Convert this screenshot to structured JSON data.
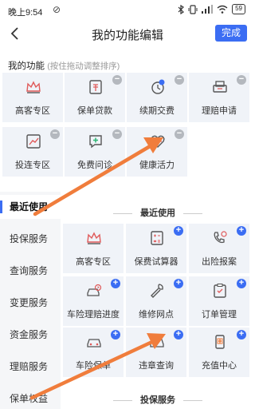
{
  "status_bar": {
    "time": "晚上9:54",
    "mute_glyph": "⊘",
    "battery": "59"
  },
  "nav": {
    "title": "我的功能编辑",
    "done": "完成"
  },
  "my_functions": {
    "title": "我的功能",
    "hint": "(按住拖动调整排序)",
    "items": [
      {
        "label": "高客专区",
        "icon": "crown-icon"
      },
      {
        "label": "保单贷款",
        "icon": "loan-doc-icon"
      },
      {
        "label": "续期交费",
        "icon": "renewal-payment-icon"
      },
      {
        "label": "理赔申请",
        "icon": "claim-print-icon"
      },
      {
        "label": "投连专区",
        "icon": "chart-trend-icon"
      },
      {
        "label": "免费问诊",
        "icon": "medical-chat-icon"
      },
      {
        "label": "健康活力",
        "icon": "health-vitality-icon"
      }
    ]
  },
  "sidebar": {
    "items": [
      "最近使用",
      "投保服务",
      "查询服务",
      "变更服务",
      "资金服务",
      "理赔服务",
      "保单权益"
    ]
  },
  "recent": {
    "title": "最近使用",
    "items": [
      {
        "label": "高客专区",
        "icon": "crown-icon"
      },
      {
        "label": "保费试算器",
        "icon": "calculator-icon"
      },
      {
        "label": "出险报案",
        "icon": "phone-report-icon"
      },
      {
        "label": "车险理赔进度",
        "icon": "car-claim-icon"
      },
      {
        "label": "维修网点",
        "icon": "wrench-icon"
      },
      {
        "label": "订单管理",
        "icon": "order-check-icon"
      },
      {
        "label": "车险保单",
        "icon": "car-icon"
      },
      {
        "label": "违章查询",
        "icon": "violation-icon"
      },
      {
        "label": "充值中心",
        "icon": "recharge-phone-icon"
      }
    ]
  },
  "insure_service": {
    "title": "投保服务"
  },
  "colors": {
    "accent": "#3b6df3",
    "tile_bg": "#f0f3f8",
    "arrow": "#f07d3c"
  }
}
